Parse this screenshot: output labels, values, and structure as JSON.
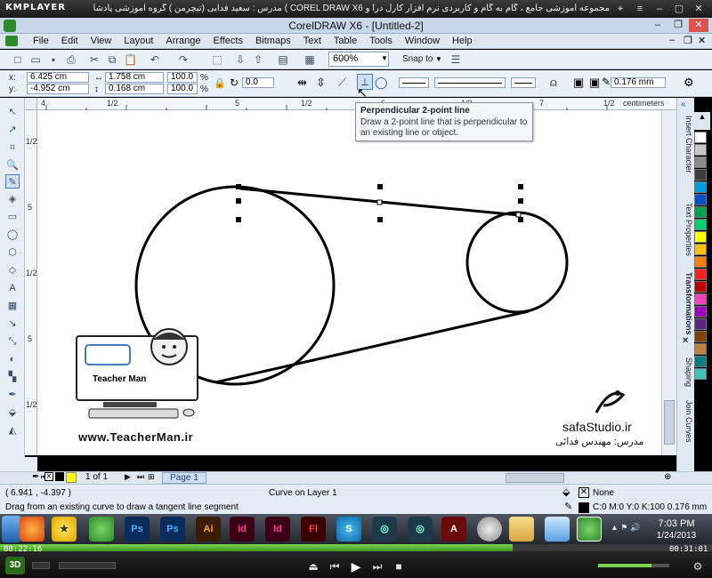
{
  "player": {
    "logo": "KMPLAYER",
    "title": "مجموعه آموزشی جامع ، گام به گام و کاربردی نرم افزار کارل درا و COREL DRAW X6 )  مدرس : سعید فدایی (تیچرمن ) گروه آموزشی پادشاه گرافیست ها",
    "time_elapsed": "00:22:16",
    "time_total": "00:31:01",
    "progress_fraction": 0.72
  },
  "app": {
    "title": "CorelDRAW X6 - [Untitled-2]"
  },
  "menu": {
    "items": [
      "File",
      "Edit",
      "View",
      "Layout",
      "Arrange",
      "Effects",
      "Bitmaps",
      "Text",
      "Table",
      "Tools",
      "Window",
      "Help"
    ]
  },
  "toolbar": {
    "zoom": "600%",
    "snap_label": "Snap to"
  },
  "property_bar": {
    "x_label": "x:",
    "x_value": "6.425 cm",
    "y_label": "y:",
    "y_value": "-4.952 cm",
    "width_value": "1.758 cm",
    "height_value": "0.168 cm",
    "scale_x": "100.0",
    "scale_y": "100.0",
    "percent": "%",
    "rotation": "0.0",
    "outline_width": "0.176 mm"
  },
  "ruler": {
    "top_ticks": [
      "4",
      "1/2",
      "5",
      "1/2",
      "6",
      "1/2",
      "7",
      "1/2"
    ],
    "top_unit": "centimeters",
    "left_ticks": [
      "1/2",
      "5",
      "1/2",
      "5",
      "1/2"
    ]
  },
  "tooltip": {
    "title": "Perpendicular 2-point line",
    "description": "Draw a 2-point line that is perpendicular to an existing line or object."
  },
  "watermark": {
    "teacherman_url": "www.TeacherMan.ir",
    "teacherman_name": "Teacher Man",
    "safa_brand": "safaStudio.ir",
    "safa_subtitle": "مدرس: مهندس فدائی"
  },
  "docker": {
    "tabs": [
      "Insert Character",
      "Text Properties",
      "Transformations",
      "Shaping",
      "Join Curves"
    ]
  },
  "page_nav": {
    "page_count": "1 of 1",
    "page_tab": "Page 1"
  },
  "status": {
    "coords": "( 6.941 , -4.397 )",
    "object_info": "Curve on Layer 1",
    "fill": "None",
    "outline": "C:0 M:0 Y:0 K:100  0.176 mm",
    "hint": "Drag from an existing curve to draw a tangent line segment"
  },
  "taskbar": {
    "icons": [
      "firefox",
      "kmplayer",
      "corel",
      "Ps",
      "Ps",
      "Ai",
      "Id",
      "Id",
      "Fl",
      "skype",
      "maya",
      "maya",
      "autocad",
      "dvd",
      "folder",
      "glass",
      "corel"
    ],
    "time": "7:03 PM",
    "date": "1/24/2013"
  },
  "palette_colors": [
    "#ffffff",
    "#c8c8c8",
    "#8c8c8c",
    "#3c3c3c",
    "#00a0e0",
    "#0050c8",
    "#00a050",
    "#00d070",
    "#ffff00",
    "#ffc000",
    "#ff8000",
    "#ff2020",
    "#c00000",
    "#ff40c0",
    "#a000c0",
    "#602080",
    "#804000",
    "#c08040",
    "#008080",
    "#40c0c0"
  ]
}
